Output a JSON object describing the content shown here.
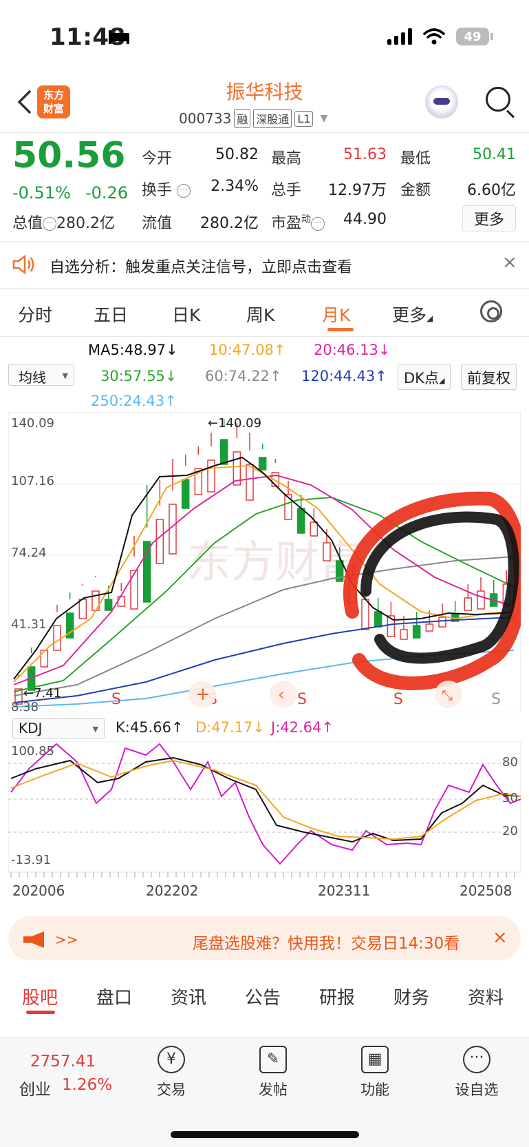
{
  "status_bar": {
    "time": "11:48",
    "battery": "49"
  },
  "header": {
    "title": "振华科技",
    "code": "000733",
    "tags": [
      "融",
      "深股通",
      "L1"
    ],
    "logo_text_1": "东方",
    "logo_text_2": "财富"
  },
  "quote": {
    "price": "50.56",
    "change_pct": "-0.51%",
    "change_abs": "-0.26",
    "open_label": "今开",
    "open": "50.82",
    "high_label": "最高",
    "high": "51.63",
    "low_label": "最低",
    "low": "50.41",
    "turnover_label": "换手",
    "turnover": "2.34%",
    "volume_label": "总手",
    "volume": "12.97万",
    "amount_label": "金额",
    "amount": "6.60亿",
    "mktcap_label": "总值",
    "mktcap": "280.2亿",
    "float_label": "流值",
    "float_cap": "280.2亿",
    "pe_label": "市盈",
    "pe_sup": "动",
    "pe": "44.90",
    "more": "更多"
  },
  "banner": {
    "text": "自选分析：触发重点关注信号，立即点击查看"
  },
  "tabs": [
    "分时",
    "五日",
    "日K",
    "周K",
    "月K",
    "更多"
  ],
  "active_tab": "月K",
  "ma_legend": {
    "selector": "均线",
    "ma5": "MA5:48.97↓",
    "ma10": "10:47.08↑",
    "ma20": "20:46.13↓",
    "ma30": "30:57.55↓",
    "ma60": "60:74.22↑",
    "ma120": "120:44.43↑",
    "ma250": "250:24.43↑",
    "dk": "DK点",
    "fq": "前复权",
    "colors": {
      "ma5": "#111111",
      "ma10": "#f5a623",
      "ma20": "#e0249a",
      "ma30": "#2aa52a",
      "ma60": "#888888",
      "ma120": "#1f3fb5",
      "ma250": "#5bb8f0"
    }
  },
  "chart": {
    "y_labels": [
      "140.09",
      "107.16",
      "74.24",
      "41.31",
      "8.38"
    ],
    "high_marker": "←140.09",
    "low_marker": "←7.41",
    "s_label": "S"
  },
  "kdj": {
    "selector": "KDJ",
    "k": "K:45.66↑",
    "d": "D:47.17↓",
    "j": "J:42.64↑",
    "y_top": "100.85",
    "y_bottom": "-13.91",
    "levels": [
      "80",
      "50",
      "20"
    ],
    "x_labels": [
      "202006",
      "202202",
      "202311",
      "202508"
    ]
  },
  "ad": {
    "text": "尾盘选股难？快用我！交易日14:30看"
  },
  "bottom_tabs": [
    "股吧",
    "盘口",
    "资讯",
    "公告",
    "研报",
    "财务",
    "资料"
  ],
  "bottom_nav": {
    "index_value": "2757.41",
    "index_name": "创业",
    "index_pct": "1.26%",
    "items": [
      "交易",
      "发帖",
      "功能",
      "设自选"
    ]
  }
}
